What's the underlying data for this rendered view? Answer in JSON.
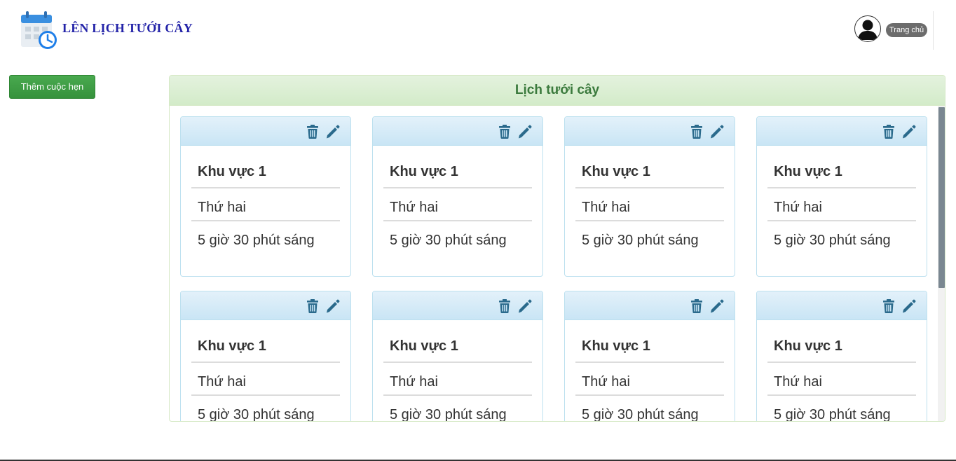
{
  "header": {
    "app_title": "LÊN LỊCH TƯỚI CÂY",
    "home_label": "Trang chủ"
  },
  "sidebar": {
    "add_button_label": "Thêm cuộc hẹn"
  },
  "panel": {
    "title": "Lịch tưới cây"
  },
  "colors": {
    "accent_green": "#3b7a3d",
    "icon_blue": "#2a6a8c",
    "title_blue": "#2323a8"
  },
  "schedules": [
    {
      "area": "Khu vực 1",
      "day": "Thứ hai",
      "time": "5 giờ 30 phút sáng"
    },
    {
      "area": "Khu vực 1",
      "day": "Thứ hai",
      "time": "5 giờ 30 phút sáng"
    },
    {
      "area": "Khu vực 1",
      "day": "Thứ hai",
      "time": "5 giờ 30 phút sáng"
    },
    {
      "area": "Khu vực 1",
      "day": "Thứ hai",
      "time": "5 giờ 30 phút sáng"
    },
    {
      "area": "Khu vực 1",
      "day": "Thứ hai",
      "time": "5 giờ 30 phút sáng"
    },
    {
      "area": "Khu vực 1",
      "day": "Thứ hai",
      "time": "5 giờ 30 phút sáng"
    },
    {
      "area": "Khu vực 1",
      "day": "Thứ hai",
      "time": "5 giờ 30 phút sáng"
    },
    {
      "area": "Khu vực 1",
      "day": "Thứ hai",
      "time": "5 giờ 30 phút sáng"
    }
  ],
  "icons": {
    "logo": "calendar-clock-icon",
    "avatar": "user-icon",
    "delete": "trash-icon",
    "edit": "pencil-icon"
  }
}
